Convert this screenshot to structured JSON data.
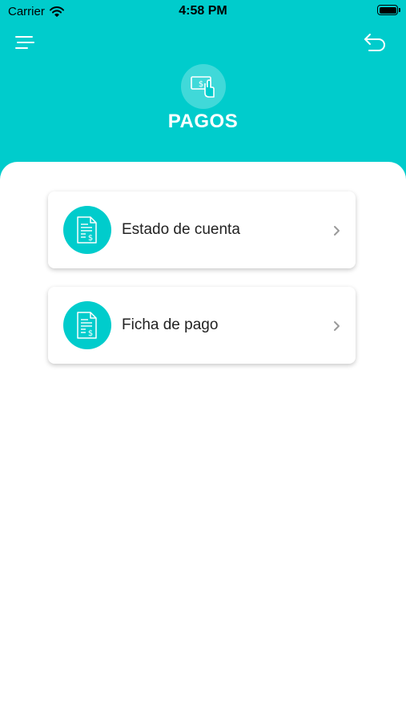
{
  "status_bar": {
    "carrier": "Carrier",
    "time": "4:58 PM"
  },
  "header": {
    "title": "PAGOS",
    "section_icon": "payment-cash-icon",
    "menu_icon": "menu-icon",
    "back_icon": "back-arrow-icon",
    "background_color": "#00cccc"
  },
  "menu_items": [
    {
      "label": "Estado de cuenta",
      "icon": "invoice-dollar-icon"
    },
    {
      "label": "Ficha de pago",
      "icon": "invoice-dollar-icon"
    }
  ],
  "colors": {
    "accent": "#00cccc",
    "text": "#222222",
    "chevron": "#9a9a9a"
  }
}
